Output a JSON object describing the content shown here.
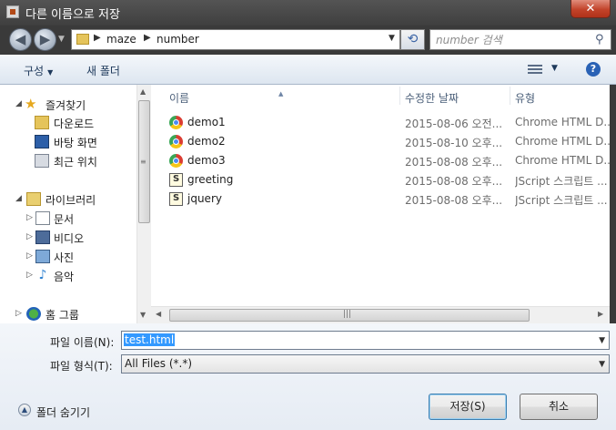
{
  "window": {
    "title": "다른 이름으로 저장",
    "close_label": "✕"
  },
  "address": {
    "breadcrumbs": [
      "maze",
      "number"
    ]
  },
  "search": {
    "placeholder": "number 검색"
  },
  "toolbar": {
    "organize_label": "구성",
    "new_folder_label": "새 폴더"
  },
  "nav": {
    "favorites": {
      "label": "즐겨찾기",
      "items": [
        "다운로드",
        "바탕 화면",
        "최근 위치"
      ]
    },
    "libraries": {
      "label": "라이브러리",
      "items": [
        "문서",
        "비디오",
        "사진",
        "음악"
      ]
    },
    "homegroup_label": "홈 그룹"
  },
  "filelist": {
    "columns": [
      "이름",
      "수정한 날짜",
      "유형"
    ],
    "rows": [
      {
        "name": "demo1",
        "date": "2015-08-06 오전...",
        "type": "Chrome HTML D...",
        "icon": "chrome-html-icon"
      },
      {
        "name": "demo2",
        "date": "2015-08-10 오후...",
        "type": "Chrome HTML D...",
        "icon": "chrome-html-icon"
      },
      {
        "name": "demo3",
        "date": "2015-08-08 오후...",
        "type": "Chrome HTML D...",
        "icon": "chrome-html-icon"
      },
      {
        "name": "greeting",
        "date": "2015-08-08 오후...",
        "type": "JScript 스크립트 ...",
        "icon": "jscript-icon"
      },
      {
        "name": "jquery",
        "date": "2015-08-08 오후...",
        "type": "JScript 스크립트 ...",
        "icon": "jscript-icon"
      }
    ]
  },
  "form": {
    "filename_label": "파일 이름(N):",
    "filename_value": "test.html",
    "filetype_label": "파일 형식(T):",
    "filetype_value": "All Files (*.*)"
  },
  "footer": {
    "hide_folders_label": "폴더 숨기기",
    "save_label": "저장(S)",
    "cancel_label": "취소"
  },
  "colors": {
    "selection": "#3399ff",
    "title_bar": "#3f3f3f",
    "close_button": "#c2432a"
  }
}
